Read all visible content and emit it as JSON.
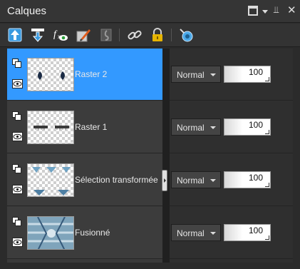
{
  "palette": {
    "title": "Calques",
    "controls": [
      "maximize-icon",
      "dropdown-icon",
      "pin-icon",
      "close-icon"
    ]
  },
  "toolbar": {
    "tools": [
      "move-up-icon",
      "move-down-icon",
      "fx-visibility-icon",
      "edit-brush-icon",
      "lock-transparency-icon",
      "link-icon",
      "lock-icon",
      "mask-icon"
    ]
  },
  "layers": [
    {
      "name": "Raster 2",
      "blend_mode": "Normal",
      "opacity": "100",
      "selected": true
    },
    {
      "name": "Raster 1",
      "blend_mode": "Normal",
      "opacity": "100",
      "selected": false
    },
    {
      "name": "Sélection transformée",
      "blend_mode": "Normal",
      "opacity": "100",
      "selected": false
    },
    {
      "name": "Fusionné",
      "blend_mode": "Normal",
      "opacity": "100",
      "selected": false
    }
  ],
  "colors": {
    "selection": "#3399ff",
    "panel_bg": "#2b2b2b",
    "icon_blue": "#4aa8e8",
    "icon_yellow": "#e6b400"
  }
}
